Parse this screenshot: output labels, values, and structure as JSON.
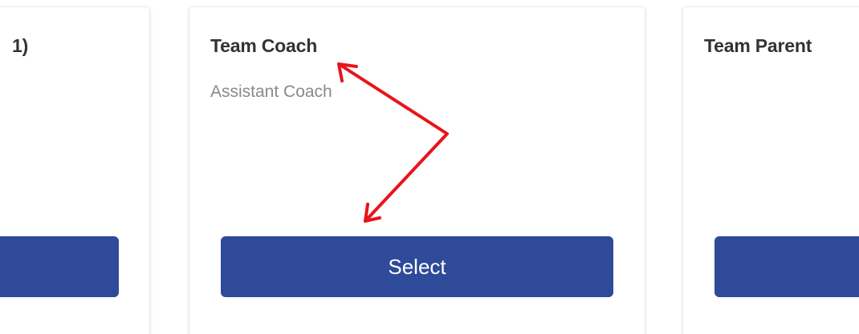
{
  "cards": [
    {
      "title": "1)",
      "subtitle": "",
      "button_label": ""
    },
    {
      "title": "Team Coach",
      "subtitle": "Assistant Coach",
      "button_label": "Select"
    },
    {
      "title": "Team Parent",
      "subtitle": "",
      "button_label": ""
    }
  ],
  "colors": {
    "button_bg": "#2e4a99",
    "button_text": "#ffffff",
    "title_text": "#333333",
    "subtitle_text": "#8a8a8a",
    "annotation_arrow": "#e8141c"
  },
  "annotation": {
    "icon": "red-double-arrow-icon"
  }
}
